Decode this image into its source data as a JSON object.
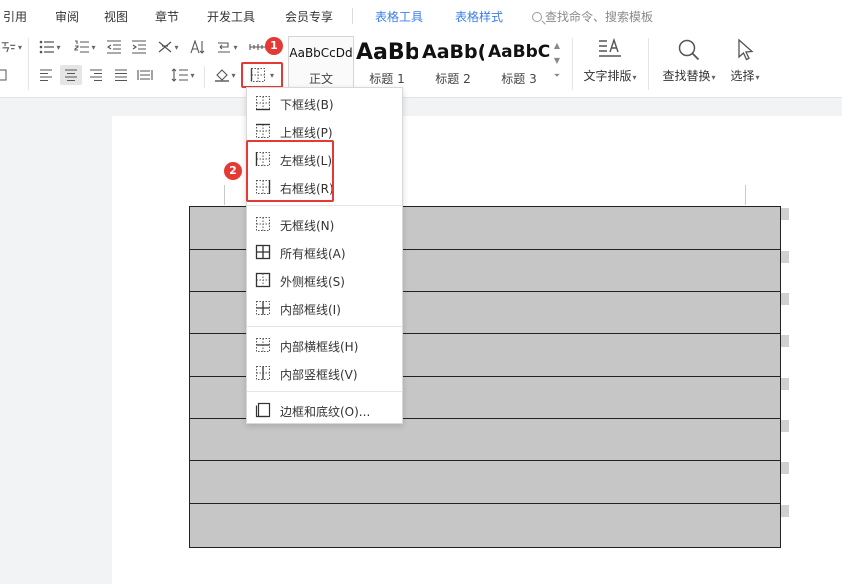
{
  "tabs": [
    {
      "label": "引用"
    },
    {
      "label": "审阅"
    },
    {
      "label": "视图"
    },
    {
      "label": "章节"
    },
    {
      "label": "开发工具"
    },
    {
      "label": "会员专享"
    },
    {
      "label": "表格工具"
    },
    {
      "label": "表格样式"
    }
  ],
  "search": {
    "placeholder": "查找命令、搜索模板"
  },
  "styles": [
    {
      "sample": "AaBbCcDd",
      "caption": "正文"
    },
    {
      "sample": "AaBb",
      "caption": "标题 1"
    },
    {
      "sample": "AaBb(",
      "caption": "标题 2"
    },
    {
      "sample": "AaBbC",
      "caption": "标题 3"
    }
  ],
  "ribbon": {
    "text_layout_label": "文字排版",
    "find_replace_label": "查找替换",
    "select_label": "选择"
  },
  "callouts": {
    "step1": "1",
    "step2": "2"
  },
  "border_menu": {
    "items": [
      {
        "label": "下框线(B)",
        "icon": "bottom-border-icon"
      },
      {
        "label": "上框线(P)",
        "icon": "top-border-icon"
      },
      {
        "label": "左框线(L)",
        "icon": "left-border-icon"
      },
      {
        "label": "右框线(R)",
        "icon": "right-border-icon"
      },
      {
        "label": "无框线(N)",
        "icon": "no-border-icon"
      },
      {
        "label": "所有框线(A)",
        "icon": "all-borders-icon"
      },
      {
        "label": "外侧框线(S)",
        "icon": "outside-borders-icon"
      },
      {
        "label": "内部框线(I)",
        "icon": "inside-borders-icon"
      },
      {
        "label": "内部横框线(H)",
        "icon": "inside-horizontal-border-icon"
      },
      {
        "label": "内部竖框线(V)",
        "icon": "inside-vertical-border-icon"
      },
      {
        "label": "边框和底纹(O)...",
        "icon": "borders-and-shading-icon"
      }
    ]
  },
  "colors": {
    "accent": "#3d7dea",
    "highlight": "#e53935",
    "table_fill": "#c6c6c6"
  }
}
